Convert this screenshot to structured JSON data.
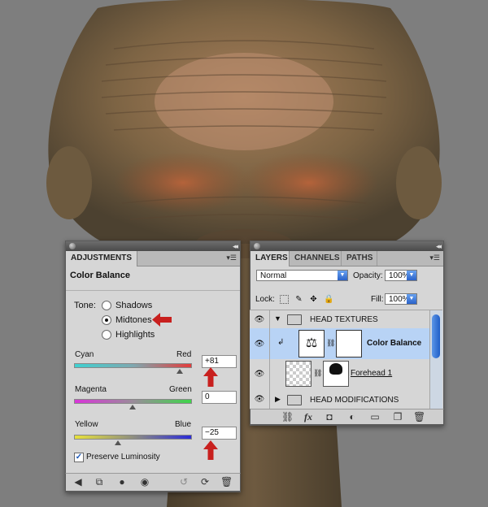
{
  "adjustments_panel": {
    "tab_label": "ADJUSTMENTS",
    "title": "Color Balance",
    "tone_label": "Tone:",
    "tones": [
      {
        "label": "Shadows",
        "checked": false
      },
      {
        "label": "Midtones",
        "checked": true
      },
      {
        "label": "Highlights",
        "checked": false
      }
    ],
    "sliders": [
      {
        "left_label": "Cyan",
        "right_label": "Red",
        "value": "+81",
        "gradient": [
          "#3fd1d1",
          "#e33c3c"
        ],
        "position": 81
      },
      {
        "left_label": "Magenta",
        "right_label": "Green",
        "value": "0",
        "gradient": [
          "#d935d9",
          "#3ed64a"
        ],
        "position": 0
      },
      {
        "left_label": "Yellow",
        "right_label": "Blue",
        "value": "−25",
        "gradient": [
          "#e8e23b",
          "#2b2bd8"
        ],
        "position": -25
      }
    ],
    "preserve_luminosity_label": "Preserve Luminosity",
    "preserve_luminosity_checked": true,
    "bottom_icons": [
      "back-arrow-icon",
      "expand-view-icon",
      "clip-to-layer-icon",
      "visibility-eye-icon",
      "view-previous-icon",
      "reset-icon",
      "delete-icon"
    ]
  },
  "layers_panel": {
    "tabs": [
      {
        "label": "LAYERS",
        "active": true
      },
      {
        "label": "CHANNELS",
        "active": false
      },
      {
        "label": "PATHS",
        "active": false
      }
    ],
    "blend_mode": "Normal",
    "opacity_label": "Opacity:",
    "opacity_value": "100%",
    "lock_label": "Lock:",
    "fill_label": "Fill:",
    "fill_value": "100%",
    "layers": [
      {
        "name": "HEAD TEXTURES",
        "kind": "group",
        "expanded": true
      },
      {
        "name": "Color Balance",
        "kind": "adjustment",
        "selected": true
      },
      {
        "name": "Forehead 1",
        "kind": "pixel"
      },
      {
        "name": "HEAD MODIFICATIONS",
        "kind": "group",
        "expanded": false
      }
    ],
    "bottom_icons": [
      "link-layers-icon",
      "fx-icon",
      "add-mask-icon",
      "new-adjustment-icon",
      "new-group-icon",
      "new-layer-icon",
      "delete-layer-icon"
    ]
  },
  "colors": {
    "annotation_red": "#c8201e",
    "selection_blue": "#b8d3f5",
    "canvas_gray": "#7e7e7e"
  }
}
